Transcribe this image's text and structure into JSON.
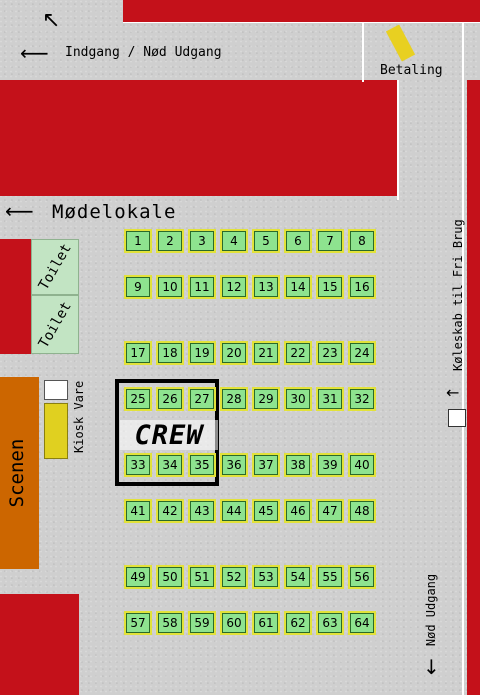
{
  "labels": {
    "entrance": "Indgang / Nød Udgang",
    "payment": "Betaling",
    "meeting_room": "Mødelokale",
    "toilet_1": "Toilet",
    "toilet_2": "Toilet",
    "kiosk": "Kiosk Vare",
    "stage": "Scenen",
    "crew": "CREW",
    "fridge": "Køleskab til Fri Brug",
    "emergency_exit": "Nød Udgang"
  },
  "seats": [
    [
      "1",
      "2",
      "3",
      "4",
      "5",
      "6",
      "7",
      "8"
    ],
    [
      "9",
      "10",
      "11",
      "12",
      "13",
      "14",
      "15",
      "16"
    ],
    [
      "17",
      "18",
      "19",
      "20",
      "21",
      "22",
      "23",
      "24"
    ],
    [
      "25",
      "26",
      "27",
      "28",
      "29",
      "30",
      "31",
      "32"
    ],
    [
      "33",
      "34",
      "35",
      "36",
      "37",
      "38",
      "39",
      "40"
    ],
    [
      "41",
      "42",
      "43",
      "44",
      "45",
      "46",
      "47",
      "48"
    ],
    [
      "49",
      "50",
      "51",
      "52",
      "53",
      "54",
      "55",
      "56"
    ],
    [
      "57",
      "58",
      "59",
      "60",
      "61",
      "62",
      "63",
      "64"
    ]
  ],
  "colors": {
    "wall": "#c4111a",
    "stage": "#cc6600",
    "kiosk": "#e0d020",
    "seat": "#8ee38f",
    "toilet": "#c2e4c3"
  }
}
